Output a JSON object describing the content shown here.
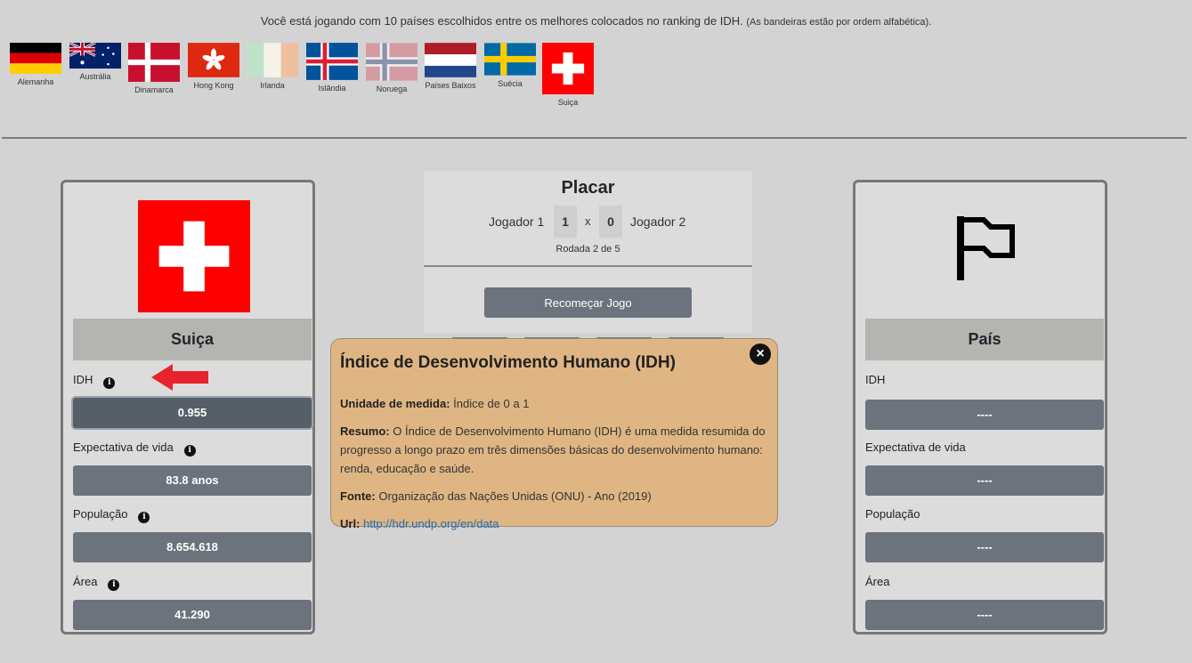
{
  "intro": {
    "text": "Você está jogando com 10 países escolhidos entre os melhores colocados no ranking de IDH.",
    "note": "(As bandeiras estão por ordem alfabética)."
  },
  "flags": [
    {
      "name": "Alemanha",
      "icon": "germany-flag-icon"
    },
    {
      "name": "Austrália",
      "icon": "australia-flag-icon"
    },
    {
      "name": "Dinamarca",
      "icon": "denmark-flag-icon"
    },
    {
      "name": "Hong Kong",
      "icon": "hong-kong-flag-icon"
    },
    {
      "name": "Irlanda",
      "icon": "ireland-flag-icon"
    },
    {
      "name": "Islândia",
      "icon": "iceland-flag-icon"
    },
    {
      "name": "Noruega",
      "icon": "norway-flag-icon"
    },
    {
      "name": "Países Baixos",
      "icon": "netherlands-flag-icon"
    },
    {
      "name": "Suécia",
      "icon": "sweden-flag-icon"
    },
    {
      "name": "Suiça",
      "icon": "switzerland-flag-icon"
    }
  ],
  "player_card": {
    "country": "Suiça",
    "stats": [
      {
        "label": "IDH",
        "value": "0.955"
      },
      {
        "label": "Expectativa de vida",
        "value": "83.8 anos"
      },
      {
        "label": "População",
        "value": "8.654.618"
      },
      {
        "label": "Área",
        "value": "41.290"
      }
    ]
  },
  "opponent_card": {
    "country": "País",
    "stats": [
      {
        "label": "IDH",
        "value": "----"
      },
      {
        "label": "Expectativa de vida",
        "value": "----"
      },
      {
        "label": "População",
        "value": "----"
      },
      {
        "label": "Área",
        "value": "----"
      }
    ]
  },
  "scoreboard": {
    "title": "Placar",
    "player1": "Jogador 1",
    "score1": "1",
    "separator": "x",
    "score2": "0",
    "player2": "Jogador 2",
    "round": "Rodada 2 de 5",
    "restart_label": "Recomeçar Jogo"
  },
  "popover": {
    "title": "Índice de Desenvolvimento Humano (IDH)",
    "unit_label": "Unidade de medida:",
    "unit_value": "Índice de 0 a 1",
    "summary_label": "Resumo:",
    "summary_value": "O Índice de Desenvolvimento Humano (IDH) é uma medida resumida do progresso a longo prazo em três dimensões básicas do desenvolvimento humano: renda, educação e saúde.",
    "source_label": "Fonte:",
    "source_value": "Organização das Nações Unidas (ONU) - Ano (2019)",
    "url_label": "Url:",
    "url_value": "http://hdr.undp.org/en/data"
  },
  "colors": {
    "background": "#d3d3d3",
    "stat_box": "#6c737d",
    "popover_bg": "#dfb683",
    "arrow": "#e8232e",
    "link": "#1b6ec2"
  }
}
